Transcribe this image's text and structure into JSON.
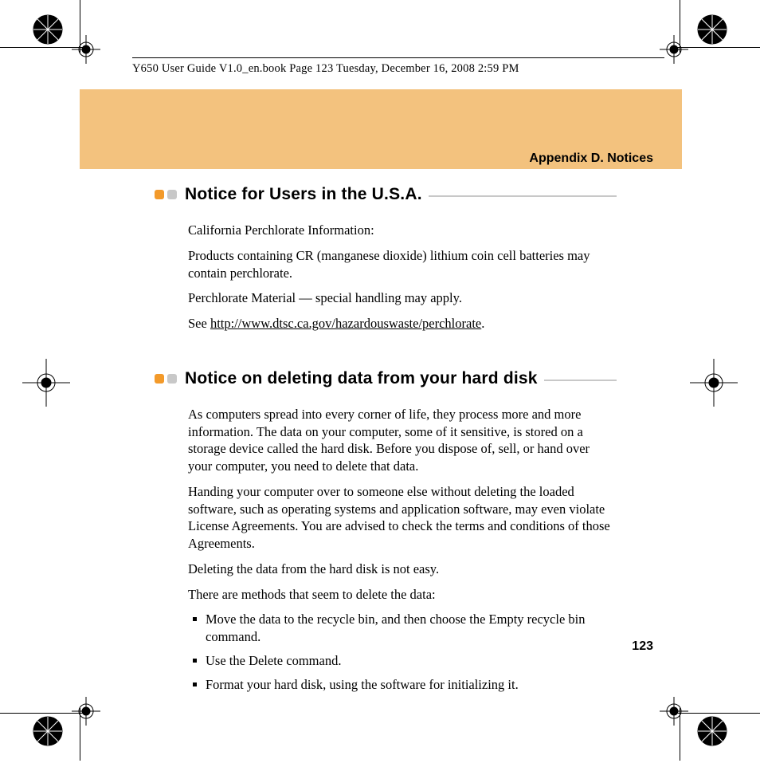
{
  "header_line": "Y650 User Guide V1.0_en.book  Page 123  Tuesday, December 16, 2008  2:59 PM",
  "band_title": "Appendix D. Notices",
  "page_number": "123",
  "sections": [
    {
      "title": "Notice for Users in the U.S.A.",
      "paragraphs": [
        "California Perchlorate Information:",
        "Products containing CR (manganese dioxide) lithium coin cell batteries may contain perchlorate.",
        "Perchlorate Material — special handling may apply."
      ],
      "see_prefix": "See ",
      "see_link": "http://www.dtsc.ca.gov/hazardouswaste/perchlorate",
      "see_suffix": "."
    },
    {
      "title": "Notice on deleting data from your hard disk",
      "paragraphs": [
        "As computers spread into every corner of life, they process more and more information. The data on your computer, some of it sensitive, is stored on a storage device called the hard disk. Before you dispose of, sell, or hand over your computer, you need to delete that data.",
        "Handing your computer over to someone else without deleting the loaded software, such as operating systems and application software, may even violate License Agreements. You are advised to check the terms and conditions of those Agreements.",
        "Deleting the data from the hard disk is not easy.",
        "There are methods that seem to delete the data:"
      ],
      "list": [
        "Move the data to the recycle bin, and then choose the Empty recycle bin command.",
        "Use the Delete command.",
        "Format your hard disk, using the software for initializing it."
      ]
    }
  ]
}
